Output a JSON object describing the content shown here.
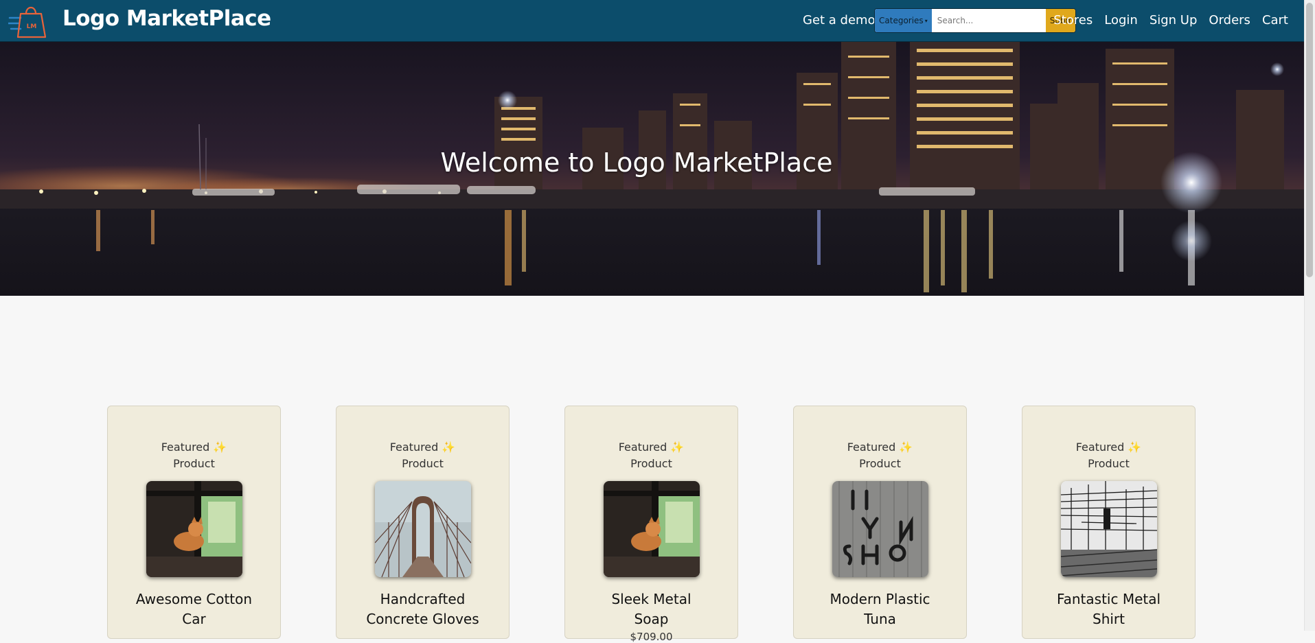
{
  "navbar": {
    "brand": "Logo MarketPlace",
    "logo_text": "LM",
    "get_demo": "Get a demo",
    "categories_label": "Categories",
    "search_placeholder": "Search...",
    "submit_label": "Submit",
    "links": {
      "stores": "Stores",
      "login": "Login",
      "signup": "Sign Up",
      "orders": "Orders",
      "cart": "Cart"
    }
  },
  "hero": {
    "title": "Welcome to Logo MarketPlace"
  },
  "products": [
    {
      "featured": "Featured ✨ Product",
      "name": "Awesome Cotton Car",
      "price": "",
      "image": "cat-window"
    },
    {
      "featured": "Featured ✨ Product",
      "name": "Handcrafted Concrete Gloves",
      "price": "",
      "image": "bridge"
    },
    {
      "featured": "Featured ✨ Product",
      "name": "Sleek Metal Soap",
      "price": "$709.00",
      "image": "cat-window"
    },
    {
      "featured": "Featured ✨ Product",
      "name": "Modern Plastic Tuna",
      "price": "",
      "image": "graffiti-wall"
    },
    {
      "featured": "Featured ✨ Product",
      "name": "Fantastic Metal Shirt",
      "price": "",
      "image": "railway-wires"
    }
  ],
  "colors": {
    "navbar": "#0c4d6b",
    "categories_button": "#2f7bbd",
    "submit_button": "#e0a81c",
    "card_background": "#f0ecdc"
  }
}
